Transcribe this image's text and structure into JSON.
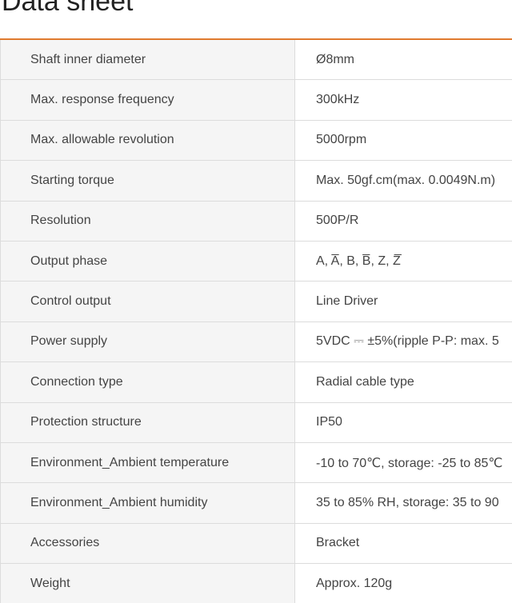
{
  "title": "Data sheet",
  "colors": {
    "accent_rule": "#e07a2f",
    "label_background": "#f5f5f5",
    "border": "#dcdcdc"
  },
  "rows": [
    {
      "label": "Shaft inner diameter",
      "value": "Ø8mm"
    },
    {
      "label": "Max. response frequency",
      "value": "300kHz"
    },
    {
      "label": "Max. allowable revolution",
      "value": "5000rpm"
    },
    {
      "label": "Starting torque",
      "value": "Max. 50gf.cm(max. 0.0049N.m)"
    },
    {
      "label": "Resolution",
      "value": "500P/R"
    },
    {
      "label": "Output phase",
      "value": "A, A̅, B, B̅, Z, Z̅"
    },
    {
      "label": "Control output",
      "value": "Line Driver"
    },
    {
      "label": "Power supply",
      "value": "5VDC ⎓ ±5%(ripple P-P: max. 5"
    },
    {
      "label": "Connection type",
      "value": "Radial cable type"
    },
    {
      "label": "Protection structure",
      "value": "IP50"
    },
    {
      "label": "Environment_Ambient temperature",
      "value": "-10 to 70℃, storage: -25 to 85℃"
    },
    {
      "label": "Environment_Ambient humidity",
      "value": "35 to 85% RH, storage: 35 to 90"
    },
    {
      "label": "Accessories",
      "value": "Bracket"
    },
    {
      "label": "Weight",
      "value": "Approx. 120g"
    }
  ]
}
